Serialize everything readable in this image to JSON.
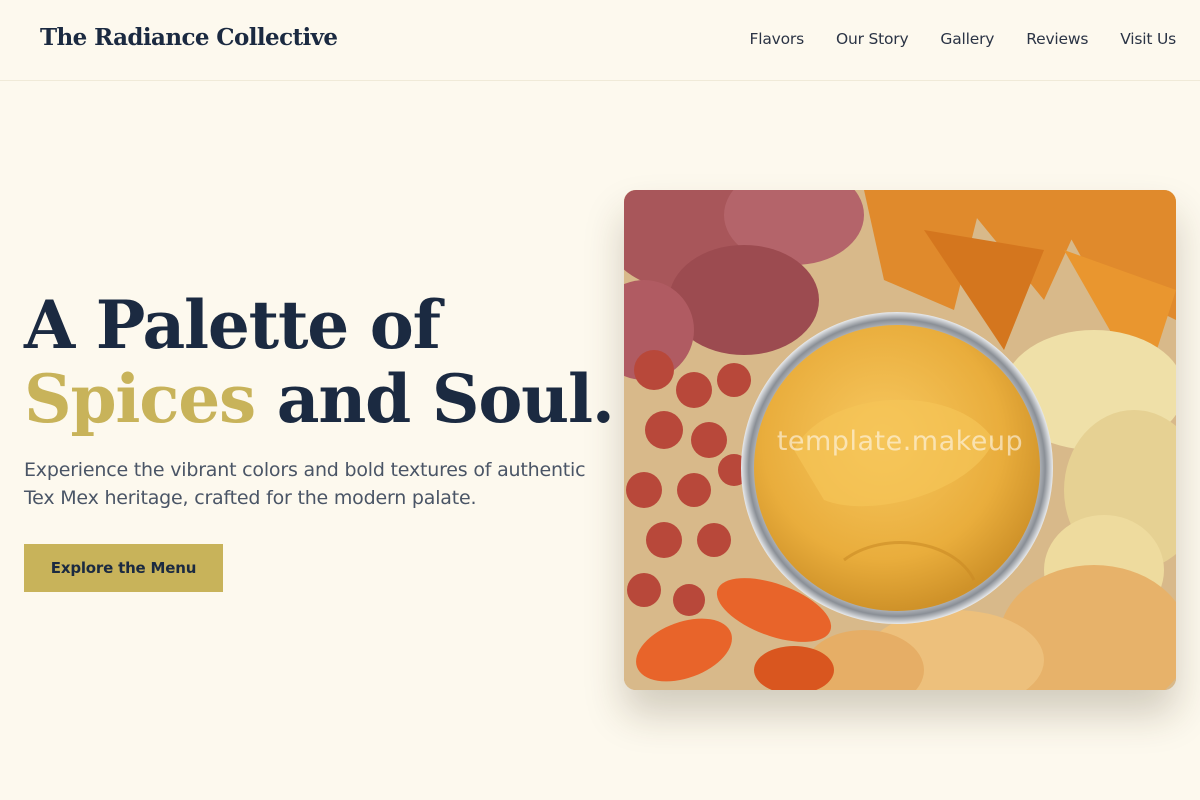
{
  "brand": {
    "name": "The Radiance Collective"
  },
  "nav": {
    "items": [
      {
        "label": "Flavors"
      },
      {
        "label": "Our Story"
      },
      {
        "label": "Gallery"
      },
      {
        "label": "Reviews"
      },
      {
        "label": "Visit Us"
      }
    ]
  },
  "hero": {
    "title_line1": "A Palette of",
    "title_accent": "Spices",
    "title_rest": " and Soul.",
    "subtitle": "Experience the vibrant colors and bold textures of authentic Tex Mex heritage, crafted for the modern palate.",
    "cta_label": "Explore the Menu"
  },
  "image": {
    "watermark": "template.makeup"
  },
  "colors": {
    "background": "#fdf9ee",
    "navy": "#1b2a41",
    "accent_gold": "#c8b35a",
    "body_text": "#4a5566"
  }
}
